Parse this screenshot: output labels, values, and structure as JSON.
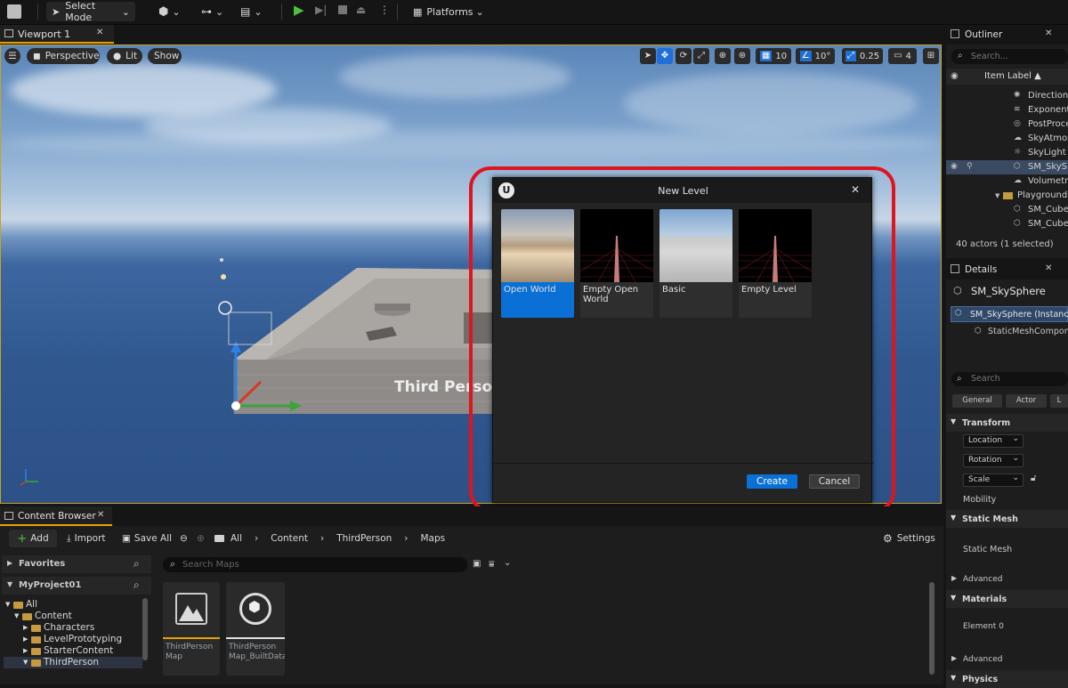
{
  "toolbar": {
    "mode_label": "Select Mode",
    "platforms_label": "Platforms"
  },
  "viewport": {
    "tab_title": "Viewport 1",
    "perspective_label": "Perspective",
    "lit_label": "Lit",
    "show_label": "Show",
    "grid_snap": "10",
    "rotation_snap": "10°",
    "scale_snap": "0.25",
    "camera_speed": "4",
    "scene_text": "Third Person"
  },
  "dialog": {
    "title": "New Level",
    "templates": [
      {
        "label": "Open World",
        "selected": true
      },
      {
        "label": "Empty Open World",
        "selected": false
      },
      {
        "label": "Basic",
        "selected": false
      },
      {
        "label": "Empty Level",
        "selected": false
      }
    ],
    "create_label": "Create",
    "cancel_label": "Cancel",
    "highlight_color": "#e0141e"
  },
  "outliner": {
    "tab_title": "Outliner",
    "search_placeholder": "Search...",
    "column_label": "Item Label ▲",
    "items": [
      {
        "label": "Directiona",
        "icon": "directional-light-icon"
      },
      {
        "label": "Exponenti",
        "icon": "fog-icon"
      },
      {
        "label": "PostProce",
        "icon": "postprocess-icon"
      },
      {
        "label": "SkyAtmos",
        "icon": "sky-atmosphere-icon"
      },
      {
        "label": "SkyLight",
        "icon": "skylight-icon"
      },
      {
        "label": "SM_SkyS",
        "icon": "static-mesh-icon",
        "selected": true
      },
      {
        "label": "Volumetri",
        "icon": "cloud-icon"
      },
      {
        "label": "Playground",
        "icon": "folder-icon"
      },
      {
        "label": "SM_Cube",
        "icon": "static-mesh-icon"
      },
      {
        "label": "SM_Cube",
        "icon": "static-mesh-icon"
      }
    ],
    "status": "40 actors (1 selected)"
  },
  "details": {
    "tab_title": "Details",
    "actor_name": "SM_SkySphere",
    "instance_label": "SM_SkySphere (Instanc",
    "component_label": "StaticMeshCompon",
    "search_placeholder": "Search",
    "filters": [
      "General",
      "Actor",
      "L"
    ],
    "transform_section": "Transform",
    "location_label": "Location",
    "rotation_label": "Rotation",
    "scale_label": "Scale",
    "mobility_label": "Mobility",
    "static_mesh_section": "Static Mesh",
    "static_mesh_label": "Static Mesh",
    "advanced_label": "Advanced",
    "materials_section": "Materials",
    "element_label": "Element 0",
    "advanced_label_2": "Advanced",
    "physics_section": "Physics"
  },
  "content_browser": {
    "tab_title": "Content Browser",
    "add_label": "Add",
    "import_label": "Import",
    "save_all_label": "Save All",
    "breadcrumb": [
      "All",
      "Content",
      "ThirdPerson",
      "Maps"
    ],
    "settings_label": "Settings",
    "favorites_label": "Favorites",
    "project_label": "MyProject01",
    "search_placeholder": "Search Maps",
    "tree": [
      {
        "label": "All",
        "depth": 0
      },
      {
        "label": "Content",
        "depth": 1
      },
      {
        "label": "Characters",
        "depth": 2
      },
      {
        "label": "LevelPrototyping",
        "depth": 2
      },
      {
        "label": "StarterContent",
        "depth": 2
      },
      {
        "label": "ThirdPerson",
        "depth": 2
      }
    ],
    "assets": [
      {
        "line1": "ThirdPerson",
        "line2": "Map"
      },
      {
        "line1": "ThirdPerson",
        "line2": "Map_BuiltData"
      }
    ]
  }
}
